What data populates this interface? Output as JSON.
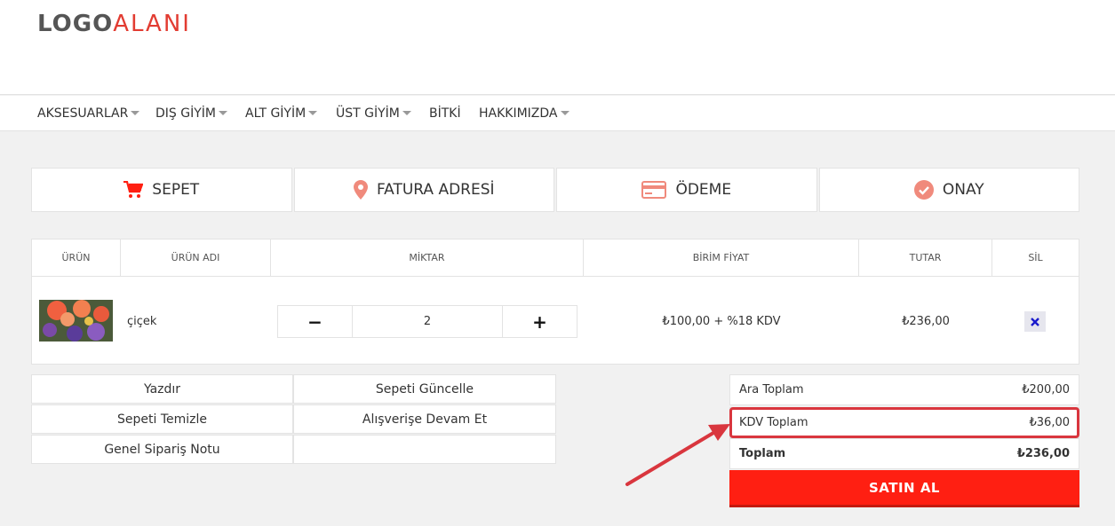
{
  "logo": {
    "part1": "LOGO",
    "part2": "ALANI"
  },
  "nav": [
    {
      "label": "AKSESUARLAR",
      "dropdown": true
    },
    {
      "label": "DIŞ GİYİM",
      "dropdown": true
    },
    {
      "label": "ALT GİYİM",
      "dropdown": true
    },
    {
      "label": "ÜST GİYİM",
      "dropdown": true
    },
    {
      "label": "BİTKİ",
      "dropdown": false
    },
    {
      "label": "HAKKIMIZDA",
      "dropdown": true
    }
  ],
  "steps": [
    {
      "label": "SEPET",
      "icon": "cart-icon"
    },
    {
      "label": "FATURA ADRESİ",
      "icon": "map-pin-icon"
    },
    {
      "label": "ÖDEME",
      "icon": "credit-card-icon"
    },
    {
      "label": "ONAY",
      "icon": "check-circle-icon"
    }
  ],
  "cart": {
    "headers": [
      "ÜRÜN",
      "ÜRÜN ADI",
      "MİKTAR",
      "BİRİM FİYAT",
      "TUTAR",
      "SİL"
    ],
    "rows": [
      {
        "name": "çiçek",
        "quantity": "2",
        "unit_price": "₺100,00 + %18 KDV",
        "total": "₺236,00"
      }
    ],
    "minus_label": "−",
    "plus_label": "+"
  },
  "actions": {
    "print": "Yazdır",
    "update": "Sepeti Güncelle",
    "clear": "Sepeti Temizle",
    "continue": "Alışverişe Devam Et",
    "note": "Genel Sipariş Notu"
  },
  "summary": {
    "subtotal_label": "Ara Toplam",
    "subtotal_value": "₺200,00",
    "vat_label": "KDV Toplam",
    "vat_value": "₺36,00",
    "total_label": "Toplam",
    "total_value": "₺236,00",
    "buy_label": "SATIN AL"
  },
  "colors": {
    "accent": "#ff1f12",
    "icon": "#f08a7c",
    "highlight": "#d9363e",
    "logo_red": "#e23c32"
  }
}
